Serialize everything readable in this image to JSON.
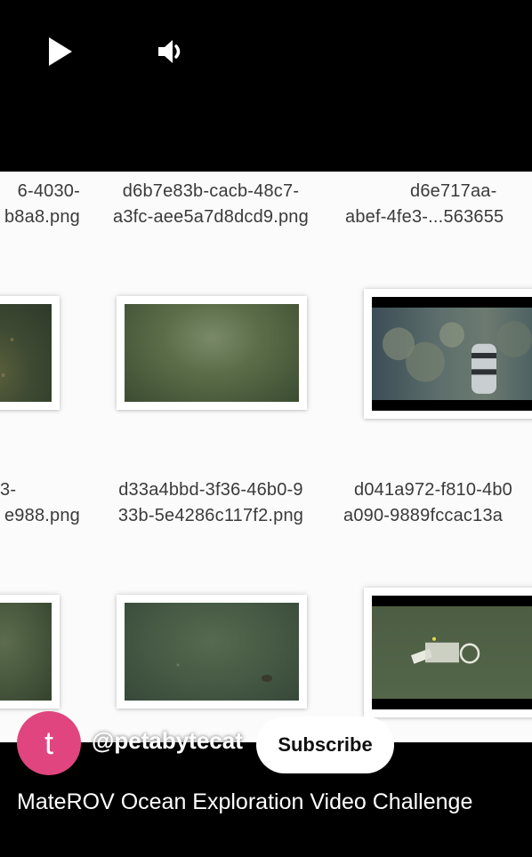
{
  "player": {
    "play_icon": "play-icon",
    "volume_icon": "volume-icon"
  },
  "grid": {
    "row1_labels": [
      {
        "line1": "6-4030-",
        "line2": "b8a8.png"
      },
      {
        "line1": "d6b7e83b-cacb-48c7-",
        "line2": "a3fc-aee5a7d8dcd9.png"
      },
      {
        "line1": "d6e717aa-",
        "line2": "abef-4fe3-...563655"
      }
    ],
    "row2_labels": [
      {
        "line1": "3-",
        "line2": "e988.png"
      },
      {
        "line1": "d33a4bbd-3f36-46b0-9",
        "line2": "33b-5e4286c117f2.png"
      },
      {
        "line1": "d041a972-f810-4b0",
        "line2": "a090-9889fccac13a"
      }
    ]
  },
  "overlay": {
    "avatar_letter": "t",
    "channel_name": "@petabytecat",
    "subscribe_label": "Subscribe",
    "video_title": "MateROV Ocean Exploration Video Challenge"
  },
  "colors": {
    "avatar_bg": "#e0457f",
    "background": "#000000"
  }
}
